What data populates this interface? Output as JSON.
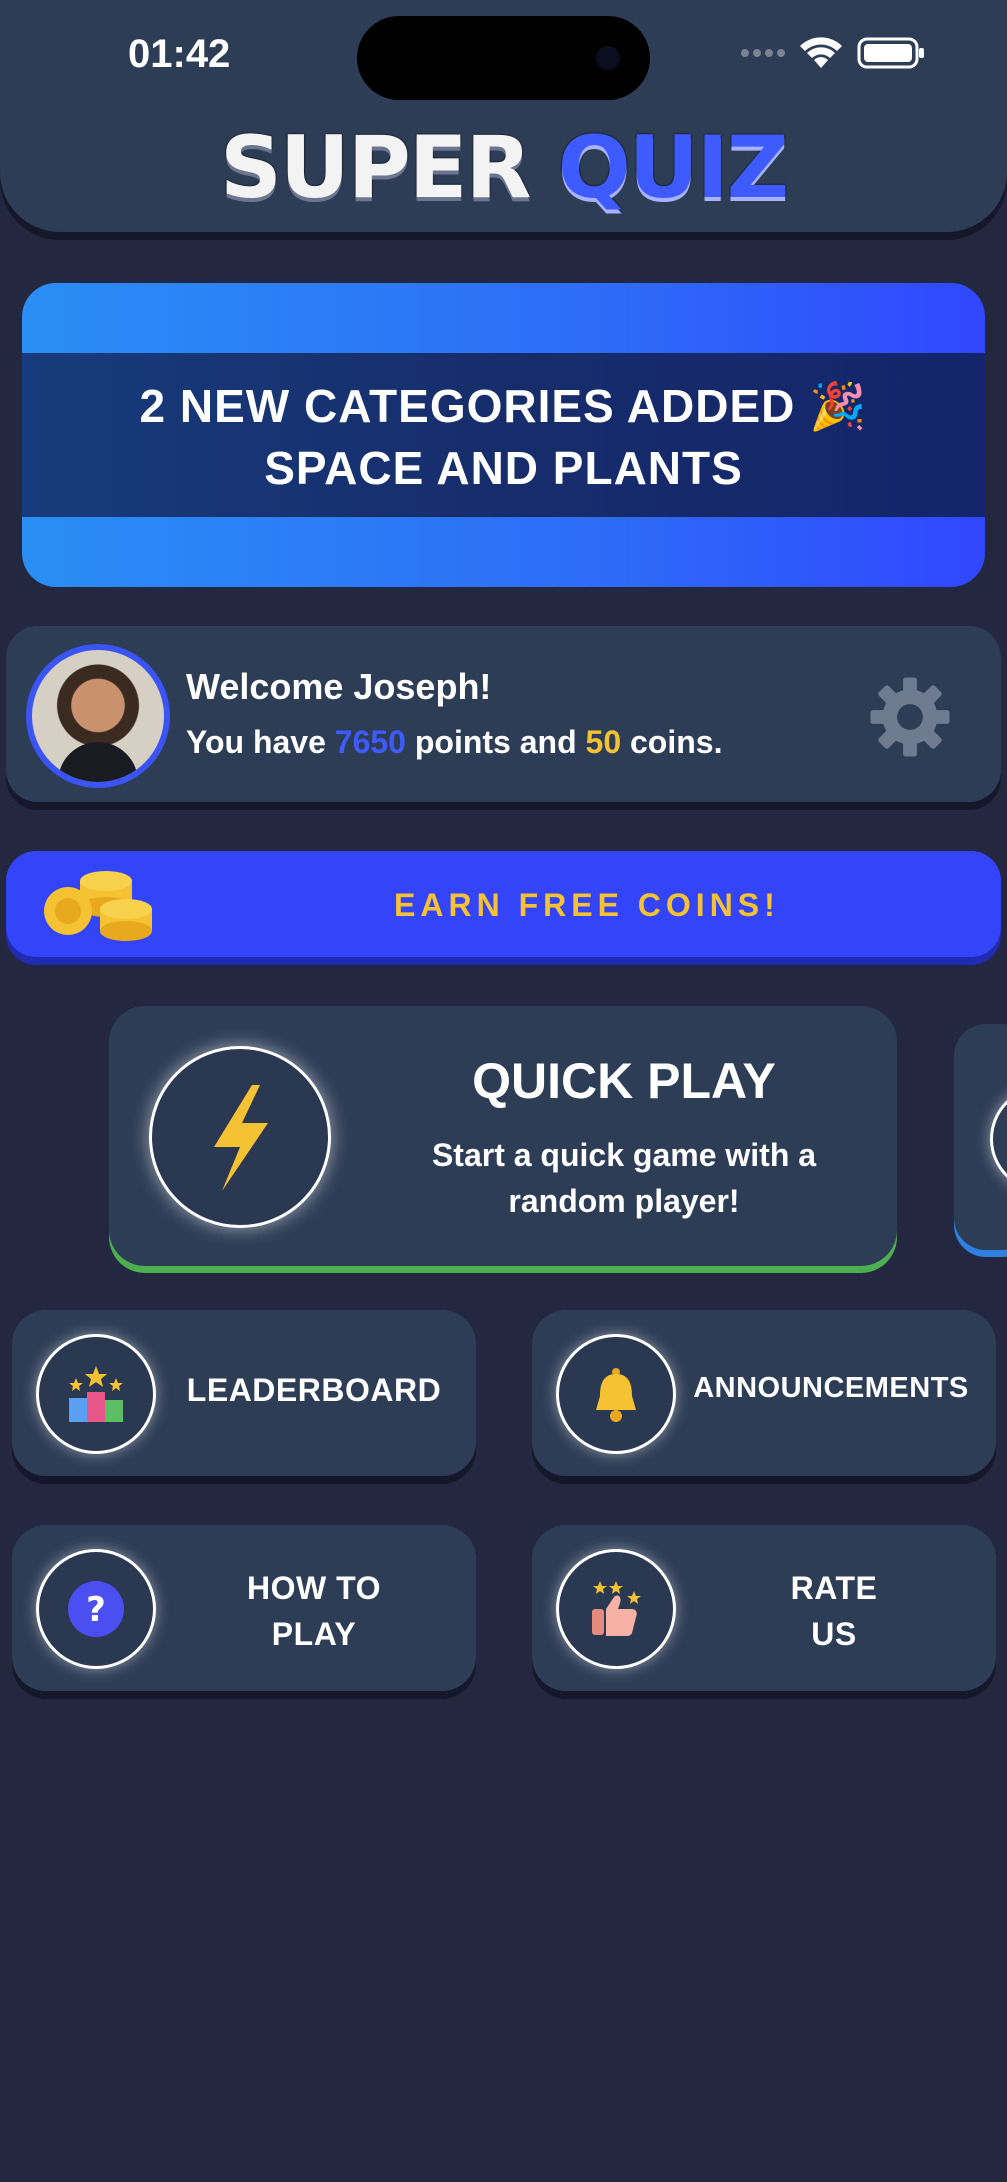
{
  "status_bar": {
    "time": "01:42"
  },
  "header": {
    "title_word1": "SUPER",
    "title_word2": "QUIZ"
  },
  "banner": {
    "line1": "2 NEW CATEGORIES ADDED 🎉",
    "line2": "SPACE AND PLANTS"
  },
  "profile": {
    "welcome": "Welcome Joseph!",
    "points_prefix": "You have",
    "points": "7650",
    "points_mid": "points and",
    "coins": "50",
    "coins_suffix": "coins."
  },
  "earn": {
    "label": "EARN FREE COINS!"
  },
  "quick_play": {
    "title": "QUICK PLAY",
    "subtitle_line1": "Start a quick game with a",
    "subtitle_line2": "random player!"
  },
  "menu": {
    "leaderboard": "LEADERBOARD",
    "announcements": "ANNOUNCEMENTS",
    "how_to_play_line1": "HOW TO",
    "how_to_play_line2": "PLAY",
    "rate_us_line1": "RATE",
    "rate_us_line2": "US"
  },
  "colors": {
    "background": "#242740",
    "card": "#2e3d56",
    "accent_blue": "#3d5bff",
    "accent_gold": "#f5c233",
    "quickplay_underline": "#4cb050"
  },
  "icons": [
    "wifi-icon",
    "battery-icon",
    "gear-icon",
    "coins-icon",
    "lightning-icon",
    "podium-icon",
    "bell-icon",
    "question-icon",
    "thumbs-up-icon"
  ]
}
